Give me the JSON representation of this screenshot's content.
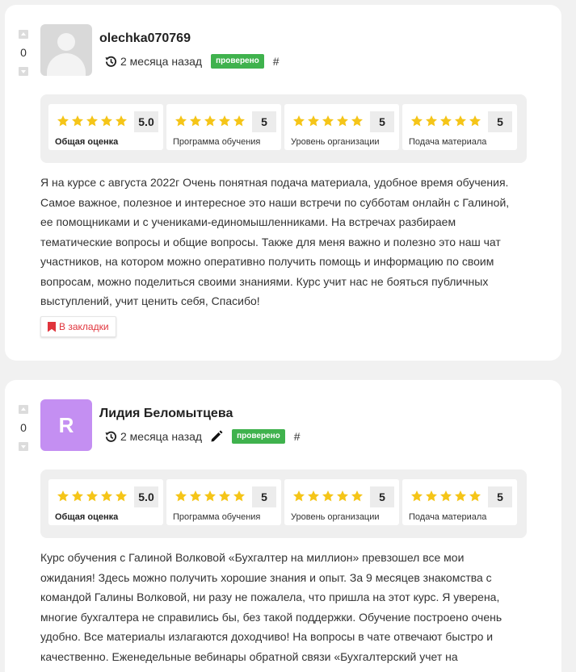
{
  "colors": {
    "star": "#f5c518",
    "verified_badge": "#3fb24d",
    "bookmark": "#e0343c",
    "avatar_letter_bg": "#c48ff2"
  },
  "reviews": [
    {
      "votes": "0",
      "author": "olechka070769",
      "avatar": "default-user-avatar",
      "time": "2 месяца назад",
      "verified_label": "проверено",
      "hash": "#",
      "ratings": [
        {
          "score": "5.0",
          "stars": 5,
          "label": "Общая оценка"
        },
        {
          "score": "5",
          "stars": 5,
          "label": "Программа обучения"
        },
        {
          "score": "5",
          "stars": 5,
          "label": "Уровень организации"
        },
        {
          "score": "5",
          "stars": 5,
          "label": "Подача материала"
        }
      ],
      "text": [
        "Я на курсе с августа 2022г Очень понятная подача материала, удобное время обучения.",
        "Самое важное, полезное и интересное это наши встречи по субботам онлайн с Галиной,",
        "ее помощниками и с учениками-единомышленниками. На встречах разбираем",
        "тематические вопросы и общие вопросы. Также для меня важно и полезно это наш чат",
        "участников, на котором можно оперативно получить помощь и информацию по своим",
        "вопросам, можно поделиться своими знаниями. Курс учит нас не бояться публичных",
        "выступлений, учит ценить себя, Спасибо!"
      ],
      "bookmark_label": "В закладки"
    },
    {
      "votes": "0",
      "author": "Лидия Беломытцева",
      "avatar_letter": "R",
      "time": "2 месяца назад",
      "verified_label": "проверено",
      "hash": "#",
      "ratings": [
        {
          "score": "5.0",
          "stars": 5,
          "label": "Общая оценка"
        },
        {
          "score": "5",
          "stars": 5,
          "label": "Программа обучения"
        },
        {
          "score": "5",
          "stars": 5,
          "label": "Уровень организации"
        },
        {
          "score": "5",
          "stars": 5,
          "label": "Подача материала"
        }
      ],
      "text": [
        "Курс обучения с Галиной Волковой «Бухгалтер на миллион» превзошел все мои",
        "ожидания! Здесь можно получить хорошие знания и опыт. За 9 месяцев знакомства с",
        "командой Галины Волковой, ни разу не пожалела, что пришла на этот курс. Я уверена,",
        "многие бухгалтера не справились бы, без такой поддержки. Обучение построено очень",
        "удобно. Все материалы излагаются доходчиво! На вопросы в чате отвечают быстро и",
        "качественно. Еженедельные вебинары обратной связи «Бухгалтерский учет на"
      ]
    }
  ]
}
